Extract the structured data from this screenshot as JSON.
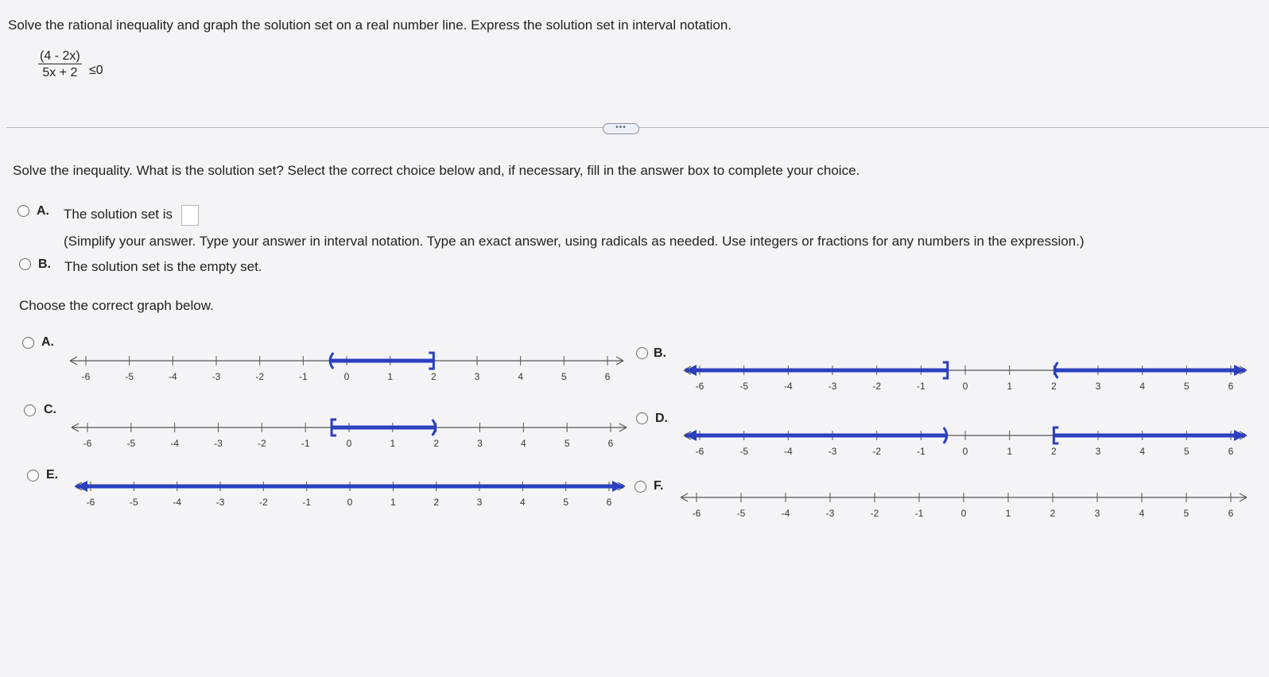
{
  "question": {
    "prompt": "Solve the rational inequality and graph the solution set on a real number line. Express the solution set in interval notation.",
    "numerator": "(4 - 2x)",
    "denominator": "5x + 2",
    "relation": "≤0"
  },
  "more_button": "•••",
  "part1": {
    "instruction": "Solve the inequality. What is the solution set? Select the correct choice below and, if necessary, fill in the answer box to complete your choice.",
    "choices": [
      {
        "letter": "A.",
        "text": "The solution set is",
        "hint": "(Simplify your answer. Type your answer in interval notation. Type an exact answer, using radicals as needed. Use integers or fractions for any numbers in the expression.)"
      },
      {
        "letter": "B.",
        "text": "The solution set is the empty set."
      }
    ],
    "answer_value": ""
  },
  "part2": {
    "instruction": "Choose the correct graph below.",
    "tick_labels": [
      "-6",
      "-5",
      "-4",
      "-3",
      "-2",
      "-1",
      "0",
      "1",
      "2",
      "3",
      "4",
      "5",
      "6"
    ],
    "graphs": [
      {
        "letter": "A.",
        "segments": [
          {
            "from": -0.4,
            "to": 2,
            "left": "open",
            "right": "closed"
          }
        ]
      },
      {
        "letter": "B.",
        "segments": [
          {
            "from": "-inf",
            "to": -0.4,
            "left": "arrow",
            "right": "closed"
          },
          {
            "from": 2,
            "to": "inf",
            "left": "open",
            "right": "arrow"
          }
        ]
      },
      {
        "letter": "C.",
        "segments": [
          {
            "from": -0.4,
            "to": 2,
            "left": "closed",
            "right": "open"
          }
        ]
      },
      {
        "letter": "D.",
        "segments": [
          {
            "from": "-inf",
            "to": -0.4,
            "left": "arrow",
            "right": "open"
          },
          {
            "from": 2,
            "to": "inf",
            "left": "closed",
            "right": "arrow"
          }
        ]
      },
      {
        "letter": "E.",
        "segments": [
          {
            "from": "-inf",
            "to": "inf",
            "left": "arrow",
            "right": "arrow"
          }
        ]
      },
      {
        "letter": "F.",
        "segments": []
      }
    ]
  },
  "colors": {
    "solution": "#2b3fc0",
    "axis": "#555555"
  }
}
